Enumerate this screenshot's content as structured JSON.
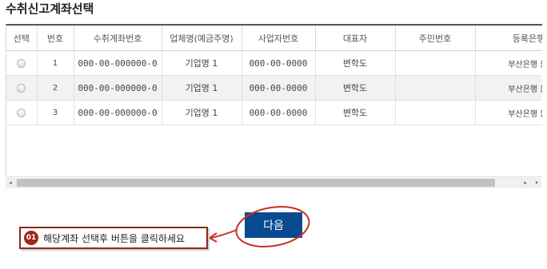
{
  "page": {
    "title": "수취신고계좌선택"
  },
  "table": {
    "columns": [
      "선택",
      "번호",
      "수취계좌번호",
      "업체명(예금주명)",
      "사업자번호",
      "대표자",
      "주민번호",
      "등록은행"
    ],
    "rows": [
      {
        "num": "1",
        "account": "000-00-000000-0",
        "company": "기업명 1",
        "biz_no": "000-00-0000",
        "ceo": "변학도",
        "resident_no": "",
        "bank": "부산은행 울산"
      },
      {
        "num": "2",
        "account": "000-00-000000-0",
        "company": "기업명 1",
        "biz_no": "000-00-0000",
        "ceo": "변학도",
        "resident_no": "",
        "bank": "부산은행 울산"
      },
      {
        "num": "3",
        "account": "000-00-000000-0",
        "company": "기업명 1",
        "biz_no": "000-00-0000",
        "ceo": "변학도",
        "resident_no": "",
        "bank": "부산은행 울산"
      }
    ]
  },
  "scrollbar": {
    "left_arrow": "◂",
    "right_arrow": "▸",
    "down_arrow": "▾"
  },
  "actions": {
    "next_label": "다음"
  },
  "callout": {
    "badge": "01",
    "text": "해당계좌 선택후 버튼을 클릭하세요"
  },
  "colors": {
    "primary_button": "#0a4a91",
    "annotation": "#c8321e",
    "callout_border": "#8c2a1e"
  },
  "icons": {
    "radio": "radio-button-icon",
    "arrow": "annotation-arrow-icon"
  }
}
